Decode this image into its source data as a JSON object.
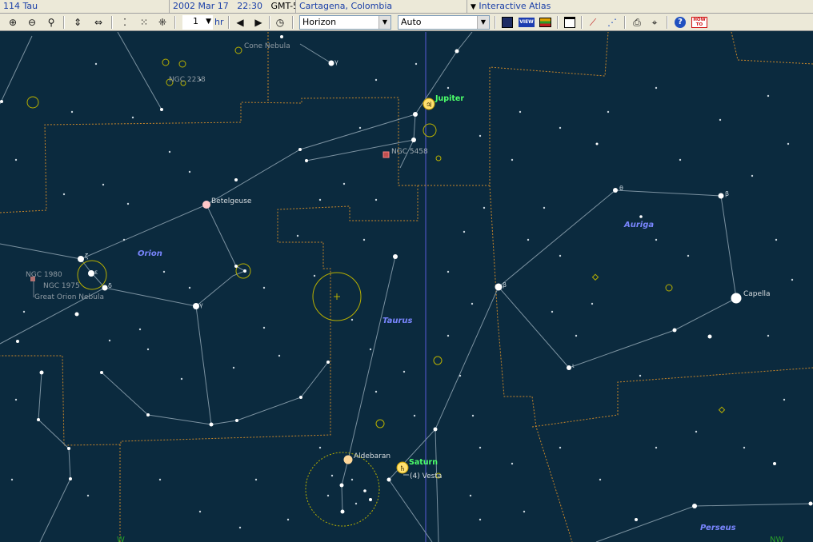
{
  "status": {
    "object": "114 Tau",
    "date": "2002 Mar 17",
    "time": "22:30",
    "tz": "GMT-5",
    "location": "Cartagena, Colombia",
    "mode": "Interactive Atlas"
  },
  "toolbar": {
    "step_value": "1",
    "step_unit": "hr",
    "view_mode": "Horizon",
    "field": "Auto",
    "view_btn": "VIEW",
    "howto_btn": "HOW TO"
  },
  "labels": {
    "cone": "Cone Nebula",
    "ngc2238": "NGC 2238",
    "jupiter": "Jupiter",
    "ngc5458": "NGC 5458",
    "betelgeuse": "Betelgeuse",
    "orion": "Orion",
    "ngc1980": "NGC 1980",
    "ngc1975": "NGC 1975",
    "orion_neb": "Great Orion Nebula",
    "taurus": "Taurus",
    "auriga": "Auriga",
    "capella": "Capella",
    "aldebaran": "Aldebaran",
    "saturn": "Saturn",
    "vesta": "(4) Vesta",
    "perseus": "Perseus",
    "dir_w": "W",
    "dir_nw": "NW",
    "g_gamma": "γ",
    "g_theta": "θ",
    "g_beta": "β",
    "g_iota": "ι",
    "g_zeta": "ζ",
    "g_epsilon": "ε",
    "g_delta": "δ"
  },
  "colors": {
    "sky": "#0b2a3e",
    "boundary": "#c8862a",
    "lines": "#8fa4b2",
    "planet_label": "#4cff6a",
    "constellation": "#7a86ff",
    "deep_sky": "#b8b000"
  }
}
